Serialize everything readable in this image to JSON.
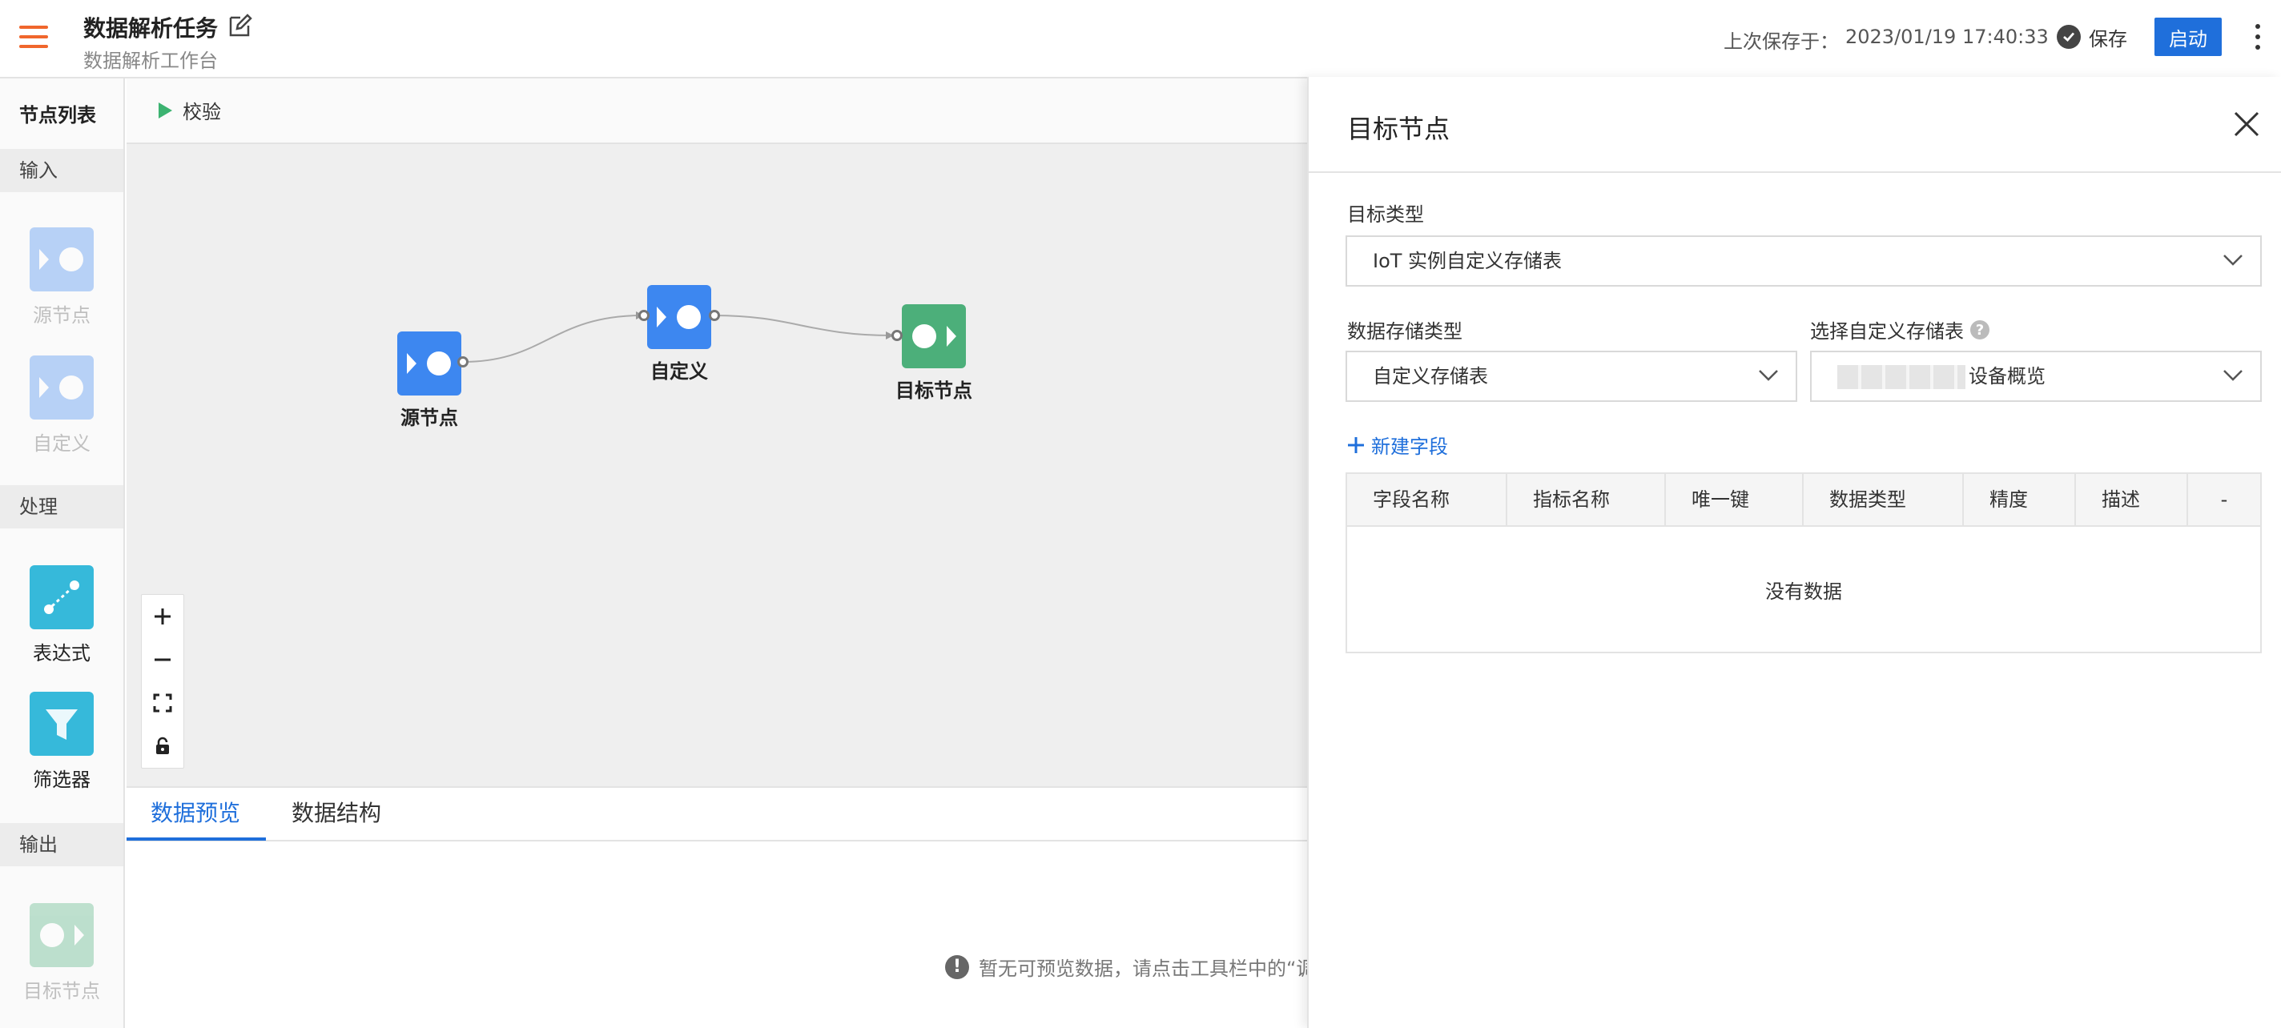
{
  "header": {
    "title": "数据解析任务",
    "subtitle": "数据解析工作台",
    "last_saved_label": "上次保存于：",
    "last_saved_time": "2023/01/19 17:40:33",
    "save_label": "保存",
    "start_label": "启动"
  },
  "node_list": {
    "title": "节点列表",
    "sections": {
      "input": "输入",
      "process": "处理",
      "output": "输出"
    },
    "items": {
      "source": "源节点",
      "custom": "自定义",
      "expression": "表达式",
      "filter": "筛选器",
      "target": "目标节点"
    }
  },
  "canvas": {
    "validate_label": "校验",
    "nodes": {
      "source": "源节点",
      "custom": "自定义",
      "target": "目标节点"
    }
  },
  "bottom_panel": {
    "tabs": [
      "数据预览",
      "数据结构"
    ],
    "active_tab": "数据预览",
    "empty_hint": "暂无可预览数据，请点击工具栏中的“调"
  },
  "side_panel": {
    "title": "目标节点",
    "target_type_label": "目标类型",
    "target_type_value": "IoT 实例自定义存储表",
    "storage_type_label": "数据存储类型",
    "storage_type_value": "自定义存储表",
    "custom_table_label": "选择自定义存储表",
    "custom_table_value": "设备概览",
    "new_field_label": "新建字段",
    "table_columns": [
      "字段名称",
      "指标名称",
      "唯一键",
      "数据类型",
      "精度",
      "描述",
      "-"
    ],
    "empty_text": "没有数据"
  },
  "colors": {
    "accent": "#1f6fdb",
    "menu": "#f0662c",
    "node_blue": "#3d87f0",
    "node_teal": "#36b9da",
    "node_green": "#4caf7a"
  }
}
